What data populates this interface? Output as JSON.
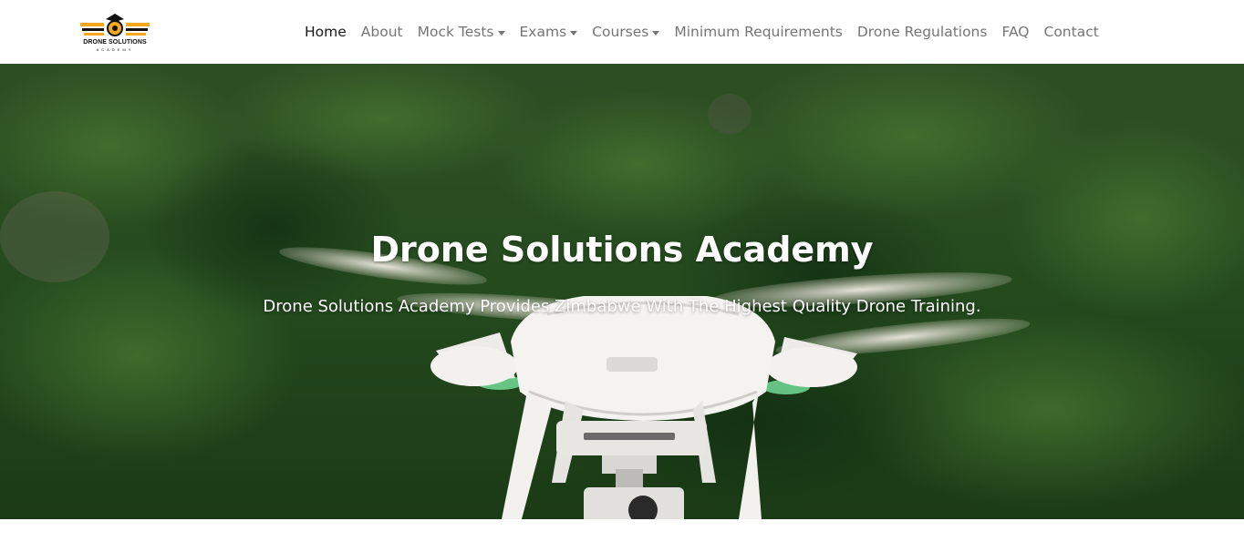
{
  "brand": {
    "logo_text": "DRONE SOLUTIONS",
    "logo_subtext": "ACADEMY",
    "colors": {
      "accent": "#f4a81d",
      "dark": "#111111"
    }
  },
  "nav": {
    "items": [
      {
        "label": "Home",
        "active": true,
        "dropdown": false
      },
      {
        "label": "About",
        "active": false,
        "dropdown": false
      },
      {
        "label": "Mock Tests",
        "active": false,
        "dropdown": true
      },
      {
        "label": "Exams",
        "active": false,
        "dropdown": true
      },
      {
        "label": "Courses",
        "active": false,
        "dropdown": true
      },
      {
        "label": "Minimum Requirements",
        "active": false,
        "dropdown": false
      },
      {
        "label": "Drone Regulations",
        "active": false,
        "dropdown": false
      },
      {
        "label": "FAQ",
        "active": false,
        "dropdown": false
      },
      {
        "label": "Contact",
        "active": false,
        "dropdown": false
      }
    ]
  },
  "hero": {
    "title": "Drone Solutions Academy",
    "subtitle": "Drone Solutions Academy Provides Zimbabwe With The Highest Quality Drone Training.",
    "image": "white quadcopter drone over green forest"
  }
}
